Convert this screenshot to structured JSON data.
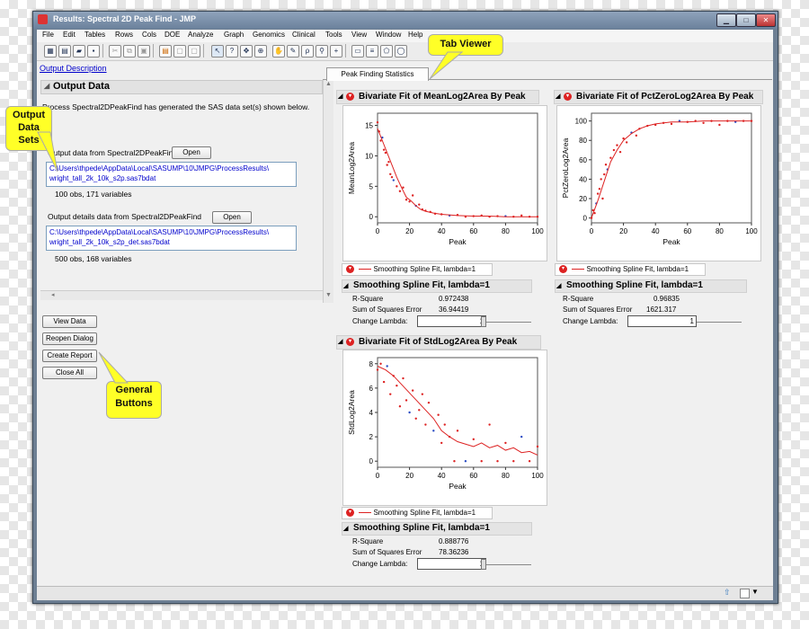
{
  "window": {
    "title": "Results: Spectral 2D Peak Find - JMP"
  },
  "menu": [
    "File",
    "Edit",
    "Tables",
    "Rows",
    "Cols",
    "DOE",
    "Analyze",
    "Graph",
    "Genomics",
    "Clinical",
    "Tools",
    "View",
    "Window",
    "Help"
  ],
  "callouts": {
    "tab_viewer": "Tab Viewer",
    "output_data_sets": "Output Data Sets",
    "general_buttons": "General Buttons"
  },
  "left": {
    "output_description_link": "Output Description",
    "panel_title": "Output Data",
    "intro": "Process Spectral2DPeakFind has generated the SAS data set(s) shown below.",
    "sets": [
      {
        "label": "Output data from Spectral2DPeakFind",
        "open": "Open",
        "path1": "C:\\Users\\thpede\\AppData\\Local\\SASUMP\\10\\JMPG\\ProcessResults\\",
        "path2": "wright_tall_2k_10k_s2p.sas7bdat",
        "info": "100 obs, 171 variables"
      },
      {
        "label": "Output details data from Spectral2DPeakFind",
        "open": "Open",
        "path1": "C:\\Users\\thpede\\AppData\\Local\\SASUMP\\10\\JMPG\\ProcessResults\\",
        "path2": "wright_tall_2k_10k_s2p_det.sas7bdat",
        "info": "500 obs, 168 variables"
      }
    ],
    "buttons": [
      "View Data",
      "Reopen Dialog",
      "Create Report",
      "Close All"
    ]
  },
  "tab": {
    "label": "Peak Finding Statistics"
  },
  "reports": [
    {
      "title": "Bivariate Fit of MeanLog2Area By Peak",
      "legend": "Smoothing Spline Fit, lambda=1",
      "fit_title": "Smoothing Spline Fit, lambda=1",
      "rsq_label": "R-Square",
      "rsq": "0.972438",
      "sse_label": "Sum of Squares Error",
      "sse": "36.94419",
      "lambda_label": "Change Lambda:",
      "lambda": "1"
    },
    {
      "title": "Bivariate Fit of PctZeroLog2Area By Peak",
      "legend": "Smoothing Spline Fit, lambda=1",
      "fit_title": "Smoothing Spline Fit, lambda=1",
      "rsq_label": "R-Square",
      "rsq": "0.96835",
      "sse_label": "Sum of Squares Error",
      "sse": "1621.317",
      "lambda_label": "Change Lambda:",
      "lambda": "1"
    },
    {
      "title": "Bivariate Fit of StdLog2Area By Peak",
      "legend": "Smoothing Spline Fit, lambda=1",
      "fit_title": "Smoothing Spline Fit, lambda=1",
      "rsq_label": "R-Square",
      "rsq": "0.888776",
      "sse_label": "Sum of Squares Error",
      "sse": "78.36236",
      "lambda_label": "Change Lambda:",
      "lambda": "1"
    }
  ],
  "chart_data": [
    {
      "type": "scatter",
      "xlabel": "Peak",
      "ylabel": "MeanLog2Area",
      "xlim": [
        0,
        100
      ],
      "ylim": [
        -1,
        17
      ],
      "xticks": [
        0,
        20,
        40,
        60,
        80,
        100
      ],
      "yticks": [
        0,
        5,
        10,
        15
      ],
      "series": [
        {
          "name": "",
          "kind": "points",
          "x": [
            0,
            1,
            2,
            3,
            4,
            5,
            6,
            7,
            8,
            9,
            10,
            12,
            14,
            16,
            18,
            20,
            22,
            24,
            26,
            28,
            30,
            33,
            36,
            40,
            45,
            50,
            55,
            60,
            65,
            70,
            75,
            80,
            85,
            90,
            95,
            100
          ],
          "y": [
            15.5,
            14,
            12.5,
            13,
            11,
            10.5,
            8.5,
            9,
            7,
            6.5,
            6,
            5,
            4.2,
            4.8,
            2.8,
            2.5,
            3.5,
            1.8,
            2,
            1.2,
            1,
            0.8,
            0.5,
            0.4,
            0.2,
            0.3,
            0,
            0.1,
            0.2,
            0,
            0.1,
            0.1,
            0,
            0.2,
            0,
            0
          ]
        },
        {
          "name": "Smoothing Spline Fit, lambda=1",
          "kind": "line",
          "x": [
            0,
            3,
            6,
            9,
            12,
            15,
            18,
            21,
            24,
            27,
            30,
            35,
            40,
            50,
            60,
            70,
            80,
            90,
            100
          ],
          "y": [
            14.5,
            12.5,
            10.5,
            8.5,
            6.5,
            4.8,
            3.2,
            2.6,
            1.8,
            1.2,
            0.9,
            0.6,
            0.4,
            0.2,
            0.1,
            0.1,
            0,
            0,
            0
          ]
        }
      ]
    },
    {
      "type": "scatter",
      "xlabel": "Peak",
      "ylabel": "PctZeroLog2Area",
      "xlim": [
        0,
        100
      ],
      "ylim": [
        -5,
        108
      ],
      "xticks": [
        0,
        20,
        40,
        60,
        80,
        100
      ],
      "yticks": [
        0,
        20,
        40,
        60,
        80,
        100
      ],
      "series": [
        {
          "name": "",
          "kind": "points",
          "x": [
            0,
            1,
            2,
            3,
            4,
            5,
            6,
            7,
            8,
            9,
            10,
            12,
            14,
            16,
            18,
            20,
            22,
            25,
            28,
            30,
            35,
            40,
            45,
            50,
            55,
            60,
            65,
            70,
            75,
            80,
            85,
            90,
            95,
            100
          ],
          "y": [
            0,
            8,
            5,
            15,
            25,
            30,
            40,
            20,
            45,
            55,
            50,
            62,
            70,
            75,
            68,
            82,
            78,
            88,
            85,
            92,
            95,
            96,
            98,
            97,
            100,
            99,
            100,
            98,
            100,
            96,
            100,
            99,
            100,
            100
          ]
        },
        {
          "name": "Smoothing Spline Fit, lambda=1",
          "kind": "line",
          "x": [
            0,
            4,
            8,
            12,
            16,
            20,
            25,
            30,
            35,
            40,
            50,
            60,
            70,
            80,
            90,
            100
          ],
          "y": [
            0,
            18,
            38,
            58,
            70,
            80,
            87,
            92,
            95,
            97,
            99,
            99,
            100,
            100,
            100,
            100
          ]
        }
      ]
    },
    {
      "type": "scatter",
      "xlabel": "Peak",
      "ylabel": "StdLog2Area",
      "xlim": [
        0,
        100
      ],
      "ylim": [
        -0.5,
        8.5
      ],
      "xticks": [
        0,
        20,
        40,
        60,
        80,
        100
      ],
      "yticks": [
        0,
        2,
        4,
        6,
        8
      ],
      "series": [
        {
          "name": "",
          "kind": "points",
          "x": [
            0,
            2,
            4,
            6,
            8,
            10,
            12,
            14,
            16,
            18,
            20,
            22,
            24,
            26,
            28,
            30,
            32,
            35,
            38,
            40,
            42,
            45,
            48,
            50,
            55,
            60,
            65,
            70,
            75,
            80,
            85,
            90,
            95,
            100
          ],
          "y": [
            7.5,
            8,
            6.5,
            7.8,
            5.5,
            7,
            6.2,
            4.5,
            6.8,
            5,
            4,
            5.8,
            3.5,
            4.2,
            5.5,
            3,
            4.8,
            2.5,
            3.8,
            1.5,
            3,
            2,
            0,
            2.5,
            0,
            1.8,
            0,
            3,
            0,
            1.5,
            0,
            2,
            0,
            1.2
          ]
        },
        {
          "name": "Smoothing Spline Fit, lambda=1",
          "kind": "line",
          "x": [
            0,
            5,
            10,
            15,
            20,
            25,
            30,
            35,
            40,
            45,
            50,
            55,
            60,
            65,
            70,
            75,
            80,
            85,
            90,
            95,
            100
          ],
          "y": [
            7.8,
            7.5,
            7,
            6.3,
            5.6,
            4.9,
            4.2,
            3.5,
            2.5,
            2,
            1.6,
            1.4,
            1.2,
            1.5,
            1.1,
            1.3,
            0.9,
            1.1,
            0.7,
            0.8,
            0.5
          ]
        }
      ]
    }
  ],
  "status": {
    "up_icon": "up-arrow-icon"
  }
}
